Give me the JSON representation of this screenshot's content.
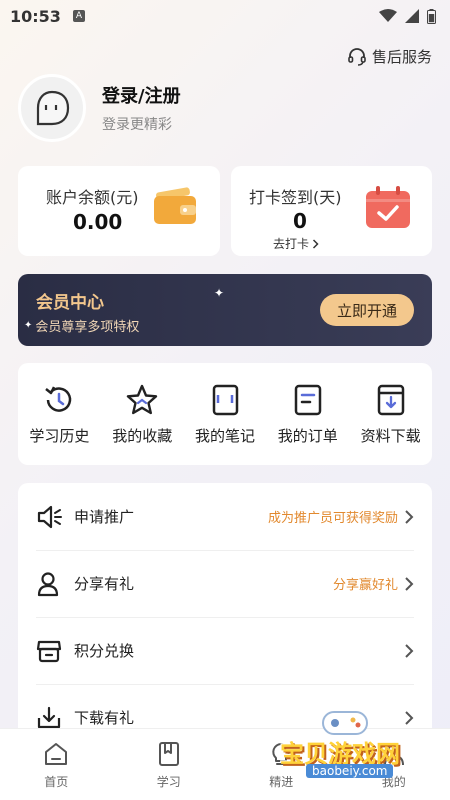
{
  "status_bar": {
    "time": "10:53",
    "a_label": "A"
  },
  "header": {
    "service_label": "售后服务"
  },
  "profile": {
    "login_label": "登录/注册",
    "subtitle": "登录更精彩"
  },
  "cards": {
    "balance": {
      "label": "账户余额(元)",
      "value": "0.00"
    },
    "checkin": {
      "label": "打卡签到(天)",
      "value": "0",
      "action": "去打卡"
    }
  },
  "vip": {
    "title": "会员中心",
    "desc": "会员尊享多项特权",
    "button": "立即开通"
  },
  "quick_actions": [
    {
      "label": "学习历史",
      "icon": "history-icon"
    },
    {
      "label": "我的收藏",
      "icon": "star-icon"
    },
    {
      "label": "我的笔记",
      "icon": "notebook-icon"
    },
    {
      "label": "我的订单",
      "icon": "order-icon"
    },
    {
      "label": "资料下载",
      "icon": "book-download-icon"
    }
  ],
  "menu": [
    {
      "label": "申请推广",
      "extra": "成为推广员可获得奖励",
      "icon": "megaphone-icon"
    },
    {
      "label": "分享有礼",
      "extra": "分享赢好礼",
      "icon": "user-icon"
    },
    {
      "label": "积分兑换",
      "extra": "",
      "icon": "shop-icon"
    },
    {
      "label": "下载有礼",
      "extra": "",
      "icon": "download-icon"
    }
  ],
  "tabbar": [
    {
      "label": "首页",
      "icon": "home-icon"
    },
    {
      "label": "学习",
      "icon": "book-icon"
    },
    {
      "label": "精进",
      "icon": "bulb-icon"
    },
    {
      "label": "我的",
      "icon": "person-icon"
    }
  ],
  "watermark": {
    "text": "宝贝游戏网",
    "url": "baobeiy.com"
  },
  "colors": {
    "accent_orange": "#e2892e",
    "vip_gold": "#f3c78d",
    "vip_dark": "#2a2d44"
  }
}
